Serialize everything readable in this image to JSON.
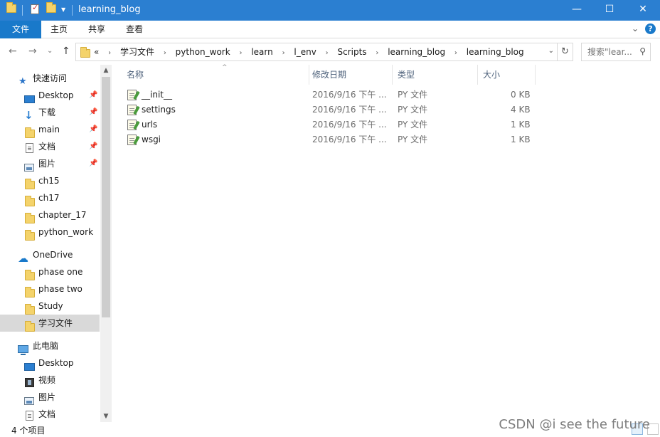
{
  "window": {
    "title": "learning_blog",
    "controls": {
      "minimize": "—",
      "maximize": "☐",
      "close": "✕"
    }
  },
  "ribbon": {
    "tabs": [
      "文件",
      "主页",
      "共享",
      "查看"
    ],
    "expand": "⌄",
    "help": "?"
  },
  "address": {
    "overflow": "«",
    "crumbs": [
      "学习文件",
      "python_work",
      "learn",
      "l_env",
      "Scripts",
      "learning_blog",
      "learning_blog"
    ],
    "separator": "›",
    "dropdown": "⌄",
    "refresh": "↻"
  },
  "search": {
    "placeholder": "搜索\"lear...",
    "icon": "⚲"
  },
  "nav_buttons": {
    "back": "←",
    "forward": "→",
    "recent": "⌄",
    "up": "↑"
  },
  "nav_pane": {
    "quick_access": {
      "label": "快速访问",
      "icon": "star-icon"
    },
    "quick_items": [
      {
        "label": "Desktop",
        "icon": "desktop-icon",
        "pinned": true
      },
      {
        "label": "下载",
        "icon": "download-icon",
        "pinned": true
      },
      {
        "label": "main",
        "icon": "folder-icon",
        "pinned": true
      },
      {
        "label": "文档",
        "icon": "documents-icon",
        "pinned": true
      },
      {
        "label": "图片",
        "icon": "pictures-icon",
        "pinned": true
      },
      {
        "label": "ch15",
        "icon": "folder-icon",
        "pinned": false
      },
      {
        "label": "ch17",
        "icon": "folder-icon",
        "pinned": false
      },
      {
        "label": "chapter_17",
        "icon": "folder-icon",
        "pinned": false
      },
      {
        "label": "python_work",
        "icon": "folder-icon",
        "pinned": false
      }
    ],
    "onedrive": {
      "label": "OneDrive",
      "icon": "cloud-icon"
    },
    "onedrive_items": [
      {
        "label": "phase one",
        "icon": "folder-icon"
      },
      {
        "label": "phase two",
        "icon": "folder-icon"
      },
      {
        "label": "Study",
        "icon": "folder-icon"
      },
      {
        "label": "学习文件",
        "icon": "folder-icon",
        "selected": true
      }
    ],
    "this_pc": {
      "label": "此电脑",
      "icon": "computer-icon"
    },
    "pc_items": [
      {
        "label": "Desktop",
        "icon": "desktop-icon"
      },
      {
        "label": "视频",
        "icon": "video-icon"
      },
      {
        "label": "图片",
        "icon": "pictures-icon"
      },
      {
        "label": "文档",
        "icon": "documents-icon"
      }
    ],
    "pin_glyph": "📌"
  },
  "file_list": {
    "columns": [
      "名称",
      "修改日期",
      "类型",
      "大小"
    ],
    "sort_indicator": "^",
    "rows": [
      {
        "name": "__init__",
        "modified": "2016/9/16 下午 ...",
        "type": "PY 文件",
        "size": "0 KB"
      },
      {
        "name": "settings",
        "modified": "2016/9/16 下午 ...",
        "type": "PY 文件",
        "size": "4 KB"
      },
      {
        "name": "urls",
        "modified": "2016/9/16 下午 ...",
        "type": "PY 文件",
        "size": "1 KB"
      },
      {
        "name": "wsgi",
        "modified": "2016/9/16 下午 ...",
        "type": "PY 文件",
        "size": "1 KB"
      }
    ]
  },
  "status": {
    "item_count": "4 个项目"
  },
  "watermark": "CSDN @i see the future",
  "colors": {
    "titlebar": "#2b7fd1",
    "file_tab": "#1979ca",
    "selected_nav": "#d9d9d9",
    "header_text": "#4c607a"
  }
}
